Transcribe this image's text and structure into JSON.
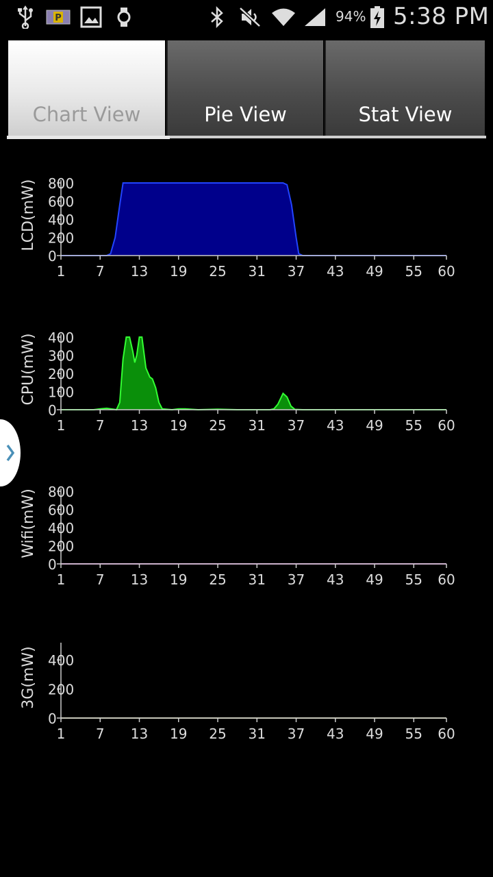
{
  "status_bar": {
    "battery_percent": "94%",
    "time": "5:38 PM",
    "icons": [
      "usb-icon",
      "parking-icon",
      "gallery-icon",
      "watch-icon",
      "bluetooth-icon",
      "mute-icon",
      "wifi-icon",
      "signal-icon",
      "battery-charging-icon"
    ]
  },
  "tabs": [
    {
      "label": "Chart View",
      "active": true
    },
    {
      "label": "Pie View",
      "active": false
    },
    {
      "label": "Stat View",
      "active": false
    }
  ],
  "colors": {
    "lcd_fill": "#00008b",
    "lcd_line": "#2244ff",
    "cpu_fill": "#0a8f0a",
    "cpu_line": "#33ff33",
    "wifi_line": "#cc66cc",
    "g3_line": "#bbbb88",
    "axis": "#cccccc"
  },
  "chart_data": [
    {
      "type": "area",
      "ylabel": "LCD(mW)",
      "ylim": [
        0,
        800
      ],
      "yticks": [
        "800",
        "600",
        "400",
        "200",
        "0"
      ],
      "xlim": [
        1,
        60
      ],
      "xticks": [
        "1",
        "7",
        "13",
        "19",
        "25",
        "31",
        "37",
        "43",
        "49",
        "55",
        "60"
      ],
      "x": [
        1,
        8,
        8.6,
        9.3,
        10,
        10.5,
        12,
        20,
        30,
        35,
        35.6,
        36.3,
        37,
        37.4,
        38,
        45,
        60
      ],
      "y": [
        0,
        0,
        20,
        200,
        560,
        800,
        800,
        800,
        800,
        800,
        780,
        560,
        200,
        20,
        0,
        0,
        0
      ]
    },
    {
      "type": "area",
      "ylabel": "CPU(mW)",
      "ylim": [
        0,
        400
      ],
      "yticks": [
        "400",
        "300",
        "200",
        "100",
        "0"
      ],
      "xlim": [
        1,
        60
      ],
      "xticks": [
        "1",
        "7",
        "13",
        "19",
        "25",
        "31",
        "37",
        "43",
        "49",
        "55",
        "60"
      ],
      "x": [
        1,
        6,
        7,
        8,
        9,
        9.5,
        10,
        10.5,
        11,
        11.5,
        12,
        12.3,
        12.6,
        13,
        13.4,
        14,
        14.6,
        15,
        15.5,
        16,
        16.5,
        18,
        19,
        20,
        22,
        25,
        28,
        33,
        33.6,
        34.2,
        35,
        35.6,
        36.2,
        36.8,
        38,
        60
      ],
      "y": [
        0,
        0,
        5,
        8,
        3,
        0,
        40,
        280,
        420,
        420,
        320,
        260,
        300,
        420,
        420,
        230,
        180,
        170,
        120,
        40,
        5,
        0,
        5,
        5,
        0,
        3,
        0,
        0,
        5,
        30,
        90,
        70,
        20,
        2,
        0,
        0
      ]
    },
    {
      "type": "line",
      "ylabel": "Wifi(mW)",
      "ylim": [
        0,
        800
      ],
      "yticks": [
        "800",
        "600",
        "400",
        "200",
        "0"
      ],
      "xlim": [
        1,
        60
      ],
      "xticks": [
        "1",
        "7",
        "13",
        "19",
        "25",
        "31",
        "37",
        "43",
        "49",
        "55",
        "60"
      ],
      "x": [
        1,
        60
      ],
      "y": [
        0,
        0
      ]
    },
    {
      "type": "line",
      "ylabel": "3G(mW)",
      "ylim": [
        0,
        500
      ],
      "yticks": [
        "400",
        "200",
        "0"
      ],
      "xlim": [
        1,
        60
      ],
      "xticks": [
        "1",
        "7",
        "13",
        "19",
        "25",
        "31",
        "37",
        "43",
        "49",
        "55",
        "60"
      ],
      "x": [
        1,
        60
      ],
      "y": [
        0,
        0
      ]
    }
  ]
}
